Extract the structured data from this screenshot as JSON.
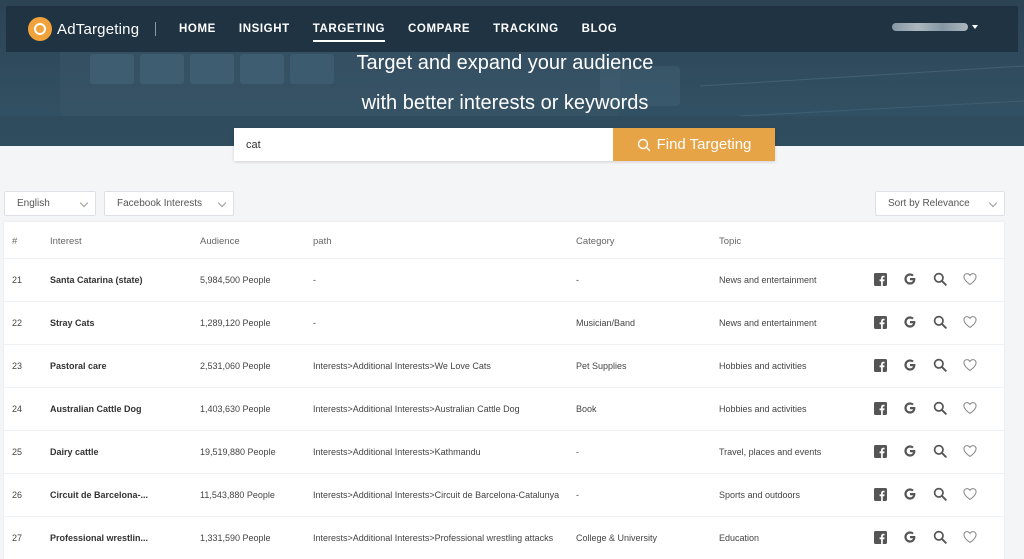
{
  "nav": {
    "brand": "AdTargeting",
    "links": [
      "HOME",
      "INSIGHT",
      "TARGETING",
      "COMPARE",
      "TRACKING",
      "BLOG"
    ],
    "active": "TARGETING"
  },
  "hero": {
    "line1": "Target and expand your audience",
    "line2": "with better interests or keywords"
  },
  "search": {
    "value": "cat",
    "button_label": "Find Targeting"
  },
  "filters": {
    "language": "English",
    "source": "Facebook Interests",
    "sort": "Sort by Relevance"
  },
  "table": {
    "headers": [
      "#",
      "Interest",
      "Audience",
      "path",
      "Category",
      "Topic"
    ],
    "rows": [
      {
        "num": "21",
        "interest": "Santa Catarina (state)",
        "audience": "5,984,500 People",
        "path": "-",
        "category": "-",
        "topic": "News and entertainment"
      },
      {
        "num": "22",
        "interest": "Stray Cats",
        "audience": "1,289,120 People",
        "path": "-",
        "category": "Musician/Band",
        "topic": "News and entertainment"
      },
      {
        "num": "23",
        "interest": "Pastoral care",
        "audience": "2,531,060 People",
        "path": "Interests>Additional Interests>We Love Cats",
        "category": "Pet Supplies",
        "topic": "Hobbies and activities"
      },
      {
        "num": "24",
        "interest": "Australian Cattle Dog",
        "audience": "1,403,630 People",
        "path": "Interests>Additional Interests>Australian Cattle Dog",
        "category": "Book",
        "topic": "Hobbies and activities"
      },
      {
        "num": "25",
        "interest": "Dairy cattle",
        "audience": "19,519,880 People",
        "path": "Interests>Additional Interests>Kathmandu",
        "category": "-",
        "topic": "Travel, places and events"
      },
      {
        "num": "26",
        "interest": "Circuit de Barcelona-...",
        "audience": "11,543,880 People",
        "path": "Interests>Additional Interests>Circuit de Barcelona-Catalunya",
        "category": "-",
        "topic": "Sports and outdoors"
      },
      {
        "num": "27",
        "interest": "Professional wrestlin...",
        "audience": "1,331,590 People",
        "path": "Interests>Additional Interests>Professional wrestling attacks",
        "category": "College & University",
        "topic": "Education"
      }
    ],
    "row_actions": [
      "facebook-icon",
      "google-icon",
      "search-icon",
      "heart-icon"
    ]
  },
  "colors": {
    "nav_bg": "#1f3343",
    "accent": "#e7a446",
    "page_bg": "#f4f5f7"
  }
}
